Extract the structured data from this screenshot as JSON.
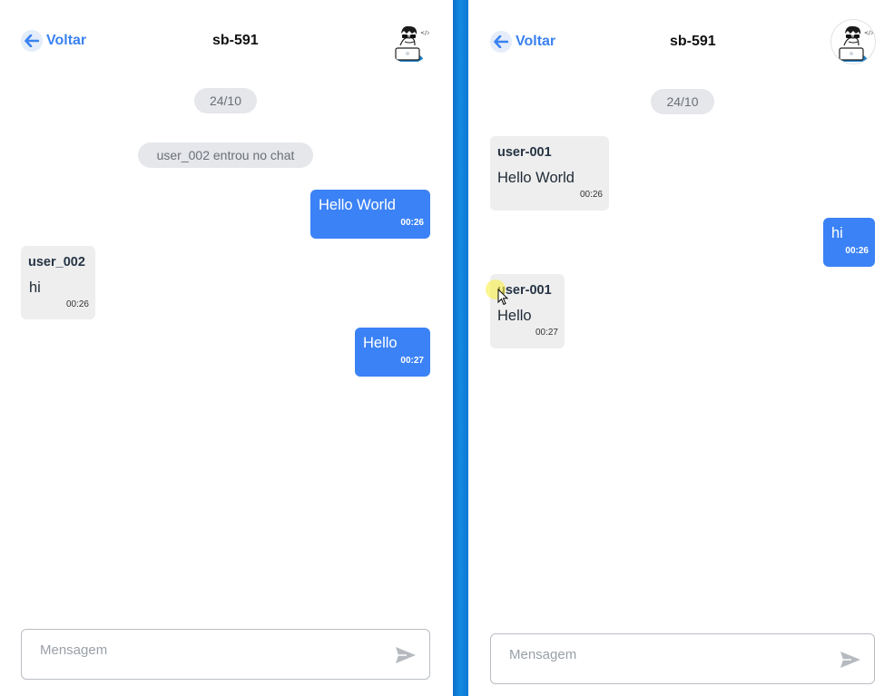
{
  "left": {
    "back_label": "Voltar",
    "title": "sb-591",
    "date": "24/10",
    "system_message": "user_002 entrou no chat",
    "messages": [
      {
        "text": "Hello World",
        "time": "00:26"
      },
      {
        "sender": "user_002",
        "text": "hi",
        "time": "00:26"
      },
      {
        "text": "Hello",
        "time": "00:27"
      }
    ],
    "input_placeholder": "Mensagem"
  },
  "right": {
    "back_label": "Voltar",
    "title": "sb-591",
    "date": "24/10",
    "messages": [
      {
        "sender": "user-001",
        "text": "Hello World",
        "time": "00:26"
      },
      {
        "text": "hi",
        "time": "00:26"
      },
      {
        "sender": "user-001",
        "text": "Hello",
        "time": "00:27"
      }
    ],
    "input_placeholder": "Mensagem"
  },
  "colors": {
    "accent": "#3b82f6",
    "link": "#3a82f0",
    "incoming_bubble": "#eeeeee",
    "date_pill": "#e5e7eb",
    "divider": "#0c7ad6"
  },
  "icons": {
    "back": "arrow-left-icon",
    "send": "send-icon",
    "avatar": "developer-avatar"
  }
}
